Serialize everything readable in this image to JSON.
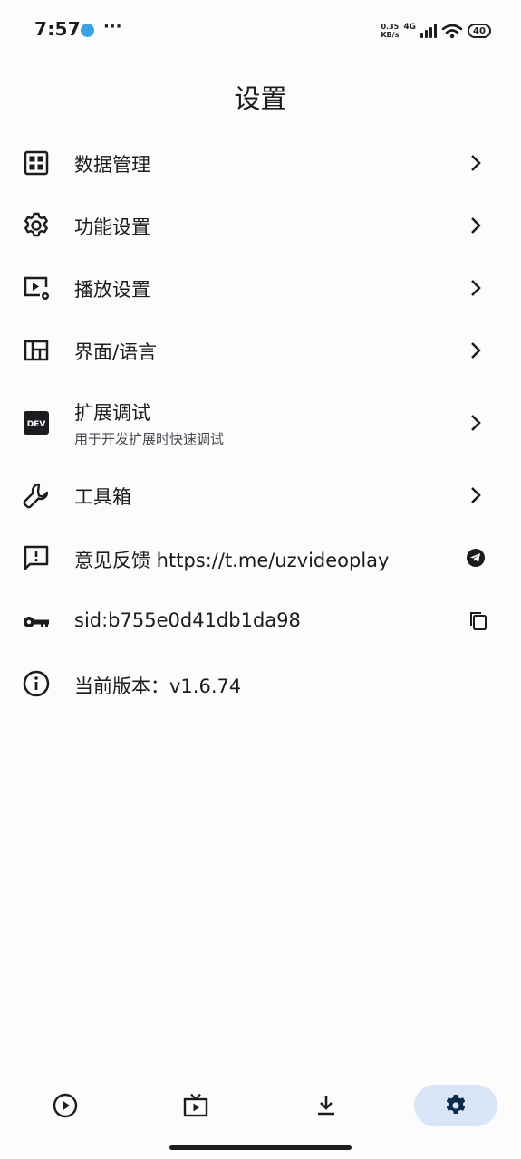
{
  "status_bar": {
    "time": "7:57",
    "overflow": "···",
    "net_speed_value": "0.35",
    "net_speed_unit": "KB/s",
    "network_type": "4G",
    "battery": "40"
  },
  "header": {
    "title": "设置"
  },
  "menu": {
    "items": [
      {
        "label": "数据管理",
        "icon": "grid-icon",
        "trailing": "chevron-right-icon"
      },
      {
        "label": "功能设置",
        "icon": "gear-icon",
        "trailing": "chevron-right-icon"
      },
      {
        "label": "播放设置",
        "icon": "video-settings-icon",
        "trailing": "chevron-right-icon"
      },
      {
        "label": "界面/语言",
        "icon": "dashboard-layout-icon",
        "trailing": "chevron-right-icon"
      },
      {
        "label": "扩展调试",
        "sublabel": "用于开发扩展时快速调试",
        "icon": "dev-badge-icon",
        "icon_text": "DEV",
        "trailing": "chevron-right-icon"
      },
      {
        "label": "工具箱",
        "icon": "wrench-icon",
        "trailing": "chevron-right-icon"
      },
      {
        "label": "意见反馈 https://t.me/uzvideoplay",
        "icon": "feedback-icon",
        "trailing": "telegram-icon"
      },
      {
        "label": "sid:b755e0d41db1da98",
        "icon": "key-icon",
        "trailing": "copy-icon"
      },
      {
        "label": "当前版本：v1.6.74",
        "icon": "info-icon"
      }
    ]
  },
  "bottom_nav": {
    "items": [
      {
        "icon": "play-circle-icon",
        "active": false
      },
      {
        "icon": "tv-icon",
        "active": false
      },
      {
        "icon": "download-icon",
        "active": false
      },
      {
        "icon": "settings-icon",
        "active": true
      }
    ],
    "active_color": "#d8e5f7"
  },
  "colors": {
    "background": "#fdfbfc",
    "text": "#1c1b1f",
    "subtext": "#49454f",
    "accent_icon": "#0b2a4a",
    "telegram": "#3ba3e0"
  }
}
